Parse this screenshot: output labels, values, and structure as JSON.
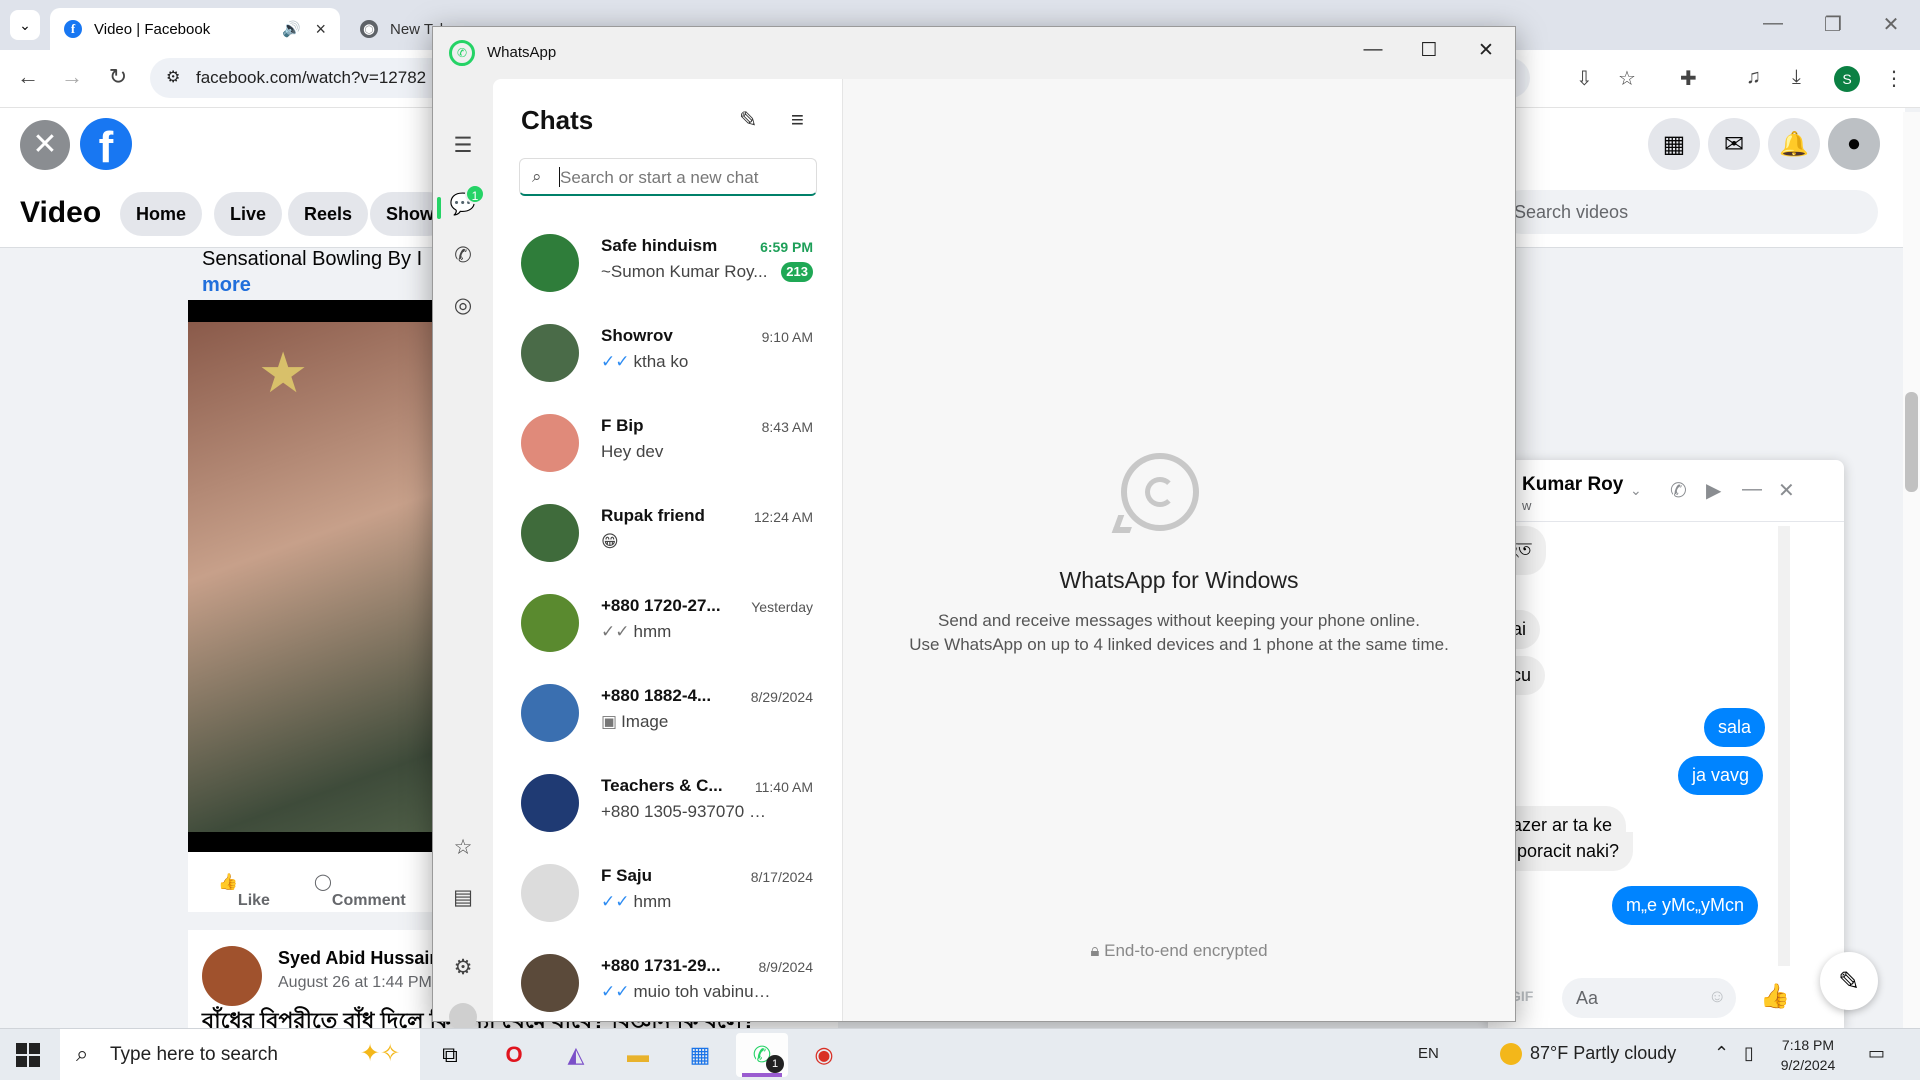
{
  "browser": {
    "tabs": [
      {
        "title": "Video | Facebook",
        "active": true
      },
      {
        "title": "New Tab",
        "active": false
      }
    ],
    "url": "facebook.com/watch?v=12782",
    "profile_initial": "S"
  },
  "facebook": {
    "header": {
      "section_title": "Video",
      "nav_pills": [
        "Home",
        "Live",
        "Reels",
        "Show"
      ],
      "search_placeholder": "Search videos"
    },
    "post": {
      "caption": "Sensational Bowling By I",
      "more_link": "more",
      "actions": {
        "like": "Like",
        "comment": "Comment"
      }
    },
    "post2": {
      "author": "Syed Abid Hussain",
      "date": "August 26 at 1:44 PM",
      "text": "বাঁধের বিপরীতে বাঁধ দিলে কি বন্যা থেমে যাবে? বিজ্ঞান কি বলে?"
    }
  },
  "messenger": {
    "contact_name": "Kumar Roy",
    "contact_sub": "w",
    "messages": [
      {
        "dir": "in",
        "text": "ছিত"
      },
      {
        "dir": "in",
        "text": "nai"
      },
      {
        "dir": "in",
        "text": "acu"
      },
      {
        "dir": "out",
        "text": "sala"
      },
      {
        "dir": "out",
        "text": "ja vavg"
      },
      {
        "dir": "in",
        "text": "bazer  ar ta ke"
      },
      {
        "dir": "in",
        "text": "a poracit naki?"
      },
      {
        "dir": "out",
        "text": "m„e yMc„yMcn"
      }
    ],
    "composer_placeholder": "Aa",
    "gif_label": "GIF"
  },
  "whatsapp": {
    "window_title": "WhatsApp",
    "rail": {
      "chats_unread": "1"
    },
    "list": {
      "title": "Chats",
      "search_placeholder": "Search or start a new chat",
      "chats": [
        {
          "name": "Safe hinduism",
          "time": "6:59 PM",
          "preview": "~Sumon Kumar Roy...",
          "unread": "213",
          "tick": "",
          "avatar_color": "#2f7d3a"
        },
        {
          "name": "Showrov",
          "time": "9:10 AM",
          "preview": "ktha ko",
          "unread": "",
          "tick": "read",
          "avatar_color": "#4a6b48"
        },
        {
          "name": "F Bip",
          "time": "8:43 AM",
          "preview": "Hey dev",
          "unread": "",
          "tick": "",
          "avatar_color": "#e08a7a"
        },
        {
          "name": "Rupak friend",
          "time": "12:24 AM",
          "preview": "😁",
          "unread": "",
          "tick": "",
          "avatar_color": "#3f6b3b"
        },
        {
          "name": "+880 1720-27...",
          "time": "Yesterday",
          "preview": "hmm",
          "unread": "",
          "tick": "sent",
          "avatar_color": "#5a8a2f"
        },
        {
          "name": "+880 1882-4...",
          "time": "8/29/2024",
          "preview": "Image",
          "unread": "",
          "tick": "image",
          "avatar_color": "#3a6fb0"
        },
        {
          "name": "Teachers & C...",
          "time": "11:40 AM",
          "preview": "+880 1305-937070 cha...",
          "unread": "",
          "tick": "",
          "avatar_color": "#1f3a73"
        },
        {
          "name": "F Saju",
          "time": "8/17/2024",
          "preview": "hmm",
          "unread": "",
          "tick": "read",
          "avatar_color": "#dcdcdc"
        },
        {
          "name": "+880 1731-29...",
          "time": "8/9/2024",
          "preview": "muio toh vabinu tui...",
          "unread": "",
          "tick": "read",
          "avatar_color": "#5b4a3a"
        }
      ]
    },
    "main": {
      "title": "WhatsApp for Windows",
      "line1": "Send and receive messages without keeping your phone online.",
      "line2": "Use WhatsApp on up to 4 linked devices and 1 phone at the same time.",
      "encrypted": "End-to-end encrypted"
    }
  },
  "taskbar": {
    "search_placeholder": "Type here to search",
    "whatsapp_badge": "1",
    "language": "EN",
    "weather": "87°F  Partly cloudy",
    "time": "7:18 PM",
    "date": "9/2/2024"
  }
}
